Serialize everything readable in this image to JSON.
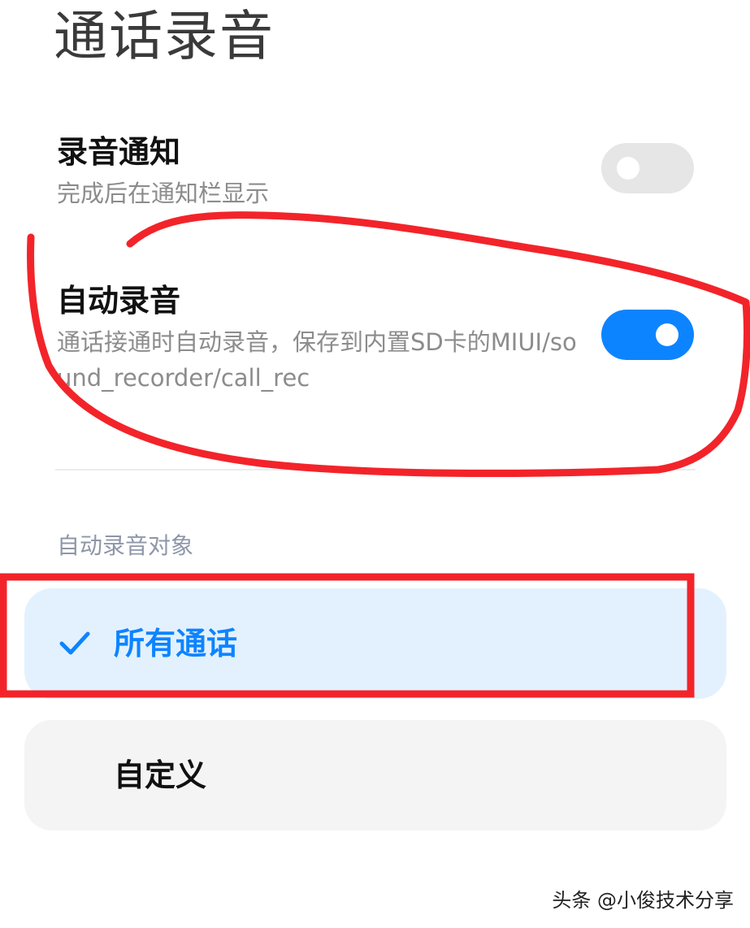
{
  "header": {
    "title": "通话录音"
  },
  "settings": [
    {
      "title": "录音通知",
      "description": "完成后在通知栏显示",
      "toggle_state": "off"
    },
    {
      "title": "自动录音",
      "description": "通话接通时自动录音，保存到内置SD卡的MIUI/sound_recorder/call_rec",
      "toggle_state": "on"
    }
  ],
  "auto_record_target": {
    "header": "自动录音对象",
    "options": [
      {
        "label": "所有通话",
        "selected": true
      },
      {
        "label": "自定义",
        "selected": false
      }
    ]
  },
  "colors": {
    "accent": "#0d84ff",
    "annotation": "#f2242a"
  },
  "watermark": "头条 @小俊技术分享"
}
